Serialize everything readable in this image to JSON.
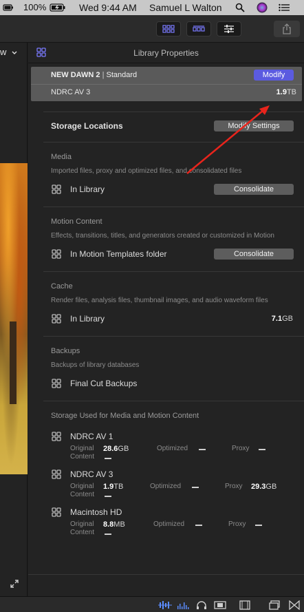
{
  "menubar": {
    "battery": "100%",
    "clock": "Wed 9:44 AM",
    "user": "Samuel L Walton"
  },
  "viewer": {
    "dropdown_label": "w"
  },
  "inspector": {
    "title": "Library Properties",
    "library": {
      "name": "NEW DAWN 2",
      "separator": "|",
      "type": "Standard",
      "modify_label": "Modify",
      "volume": "NDRC AV 3",
      "size_value": "1.9",
      "size_unit": "TB"
    },
    "storage": {
      "title": "Storage Locations",
      "modify_settings_label": "Modify Settings"
    },
    "media": {
      "title": "Media",
      "desc": "Imported files, proxy and optimized files, and consolidated files",
      "location": "In Library",
      "button": "Consolidate"
    },
    "motion": {
      "title": "Motion Content",
      "desc": "Effects, transitions, titles, and generators created or customized in Motion",
      "location": "In Motion Templates folder",
      "button": "Consolidate"
    },
    "cache": {
      "title": "Cache",
      "desc": "Render files, analysis files, thumbnail images, and audio waveform files",
      "location": "In Library",
      "size_value": "7.1",
      "size_unit": "GB"
    },
    "backups": {
      "title": "Backups",
      "desc": "Backups of library databases",
      "location": "Final Cut Backups"
    },
    "storage_used": {
      "title": "Storage Used for Media and Motion Content",
      "original_label": "Original",
      "content_label": "Content",
      "optimized_label": "Optimized",
      "proxy_label": "Proxy",
      "volumes": [
        {
          "name": "NDRC AV 1",
          "original_value": "28.6",
          "original_unit": "GB"
        },
        {
          "name": "NDRC AV 3",
          "original_value": "1.9",
          "original_unit": "TB",
          "proxy_value": "29.3",
          "proxy_unit": "GB"
        },
        {
          "name": "Macintosh HD",
          "original_value": "8.8",
          "original_unit": "MB"
        }
      ]
    }
  },
  "colors": {
    "accent": "#5b5be0",
    "annotation_arrow": "#e8241c"
  },
  "icons": [
    "battery-icon",
    "search-icon",
    "siri-icon",
    "list-icon",
    "browser-layout-icon",
    "timeline-layout-icon",
    "inspector-toggle-icon",
    "share-icon",
    "library-icon",
    "expand-icon",
    "annotation-arrow"
  ]
}
